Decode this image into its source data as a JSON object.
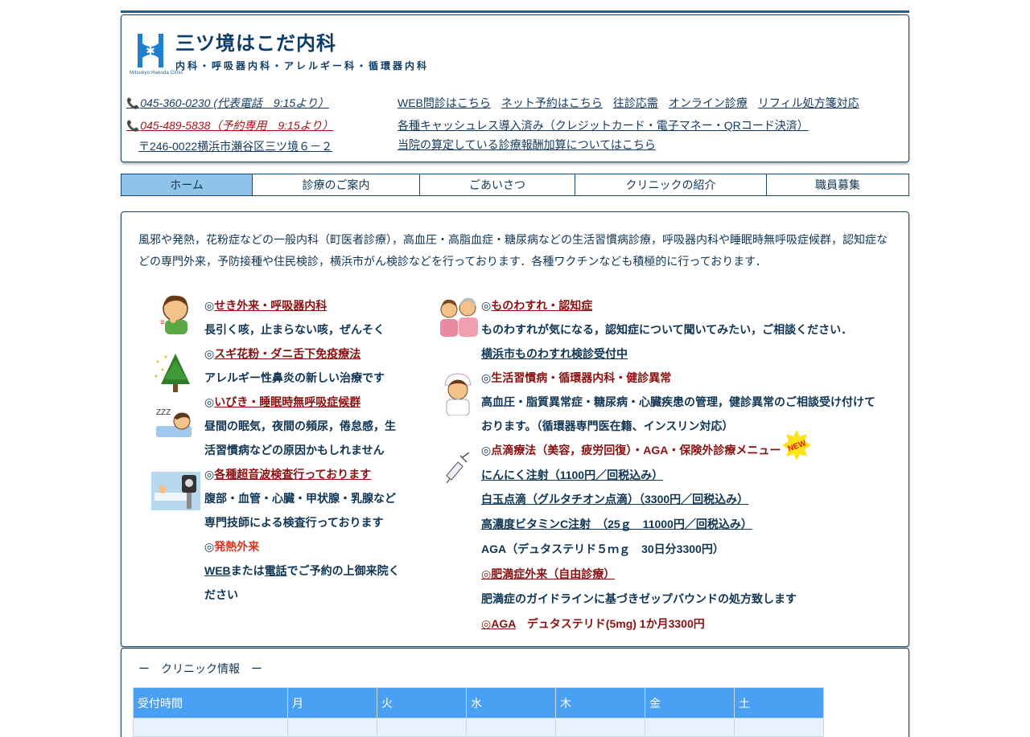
{
  "header": {
    "logo_small_text": "Mitsukyo Hakoda Clinic",
    "clinic_name": "三ツ境はこだ内科",
    "clinic_subtitle": "内科・呼吸器内科・アレルギー科・循環器内科",
    "phone_main": "045-360-0230 (代表電話　9:15より）",
    "phone_reserve": "045-489-5838（予約専用　9:15より）",
    "address": "〒246-0022横浜市瀬谷区三ツ境６－２",
    "links": [
      "WEB問診はこちら",
      "ネット予約はこちら",
      "往診応需",
      "オンライン診療",
      "リフィル処方箋対応"
    ],
    "cashless": "各種キャッシュレス導入済み（クレジットカード・電子マネー・QRコード決済）",
    "fee_link": "当院の算定している診療報酬加算についてはこちら"
  },
  "nav": {
    "tabs": [
      "ホーム",
      "診療のご案内",
      "ごあいさつ",
      "クリニックの紹介",
      "職員募集"
    ]
  },
  "main": {
    "intro": "風邪や発熱，花粉症などの一般内科（町医者診療），高血圧・高脂血症・糖尿病などの生活習慣病診療，呼吸器内科や睡眠時無呼吸症候群，認知症などの専門外来，予防接種や住民検診，横浜市がん検診などを行っております．各種ワクチンなども積極的に行っております．",
    "left": {
      "cough_mark": "◎",
      "cough_link": "せき外来・呼吸器内科",
      "cough_desc": "長引く咳，止まらない咳，ぜんそく",
      "pollen_mark": "◎",
      "pollen_link": "スギ花粉・ダニ舌下免疫療法",
      "pollen_desc": "アレルギー性鼻炎の新しい治療です",
      "sleep_mark": "◎",
      "sleep_link": "いびき・睡眠時無呼吸症候群",
      "sleep_desc_1": "昼間の眠気，夜間の頻尿，倦怠感，生",
      "sleep_desc_2": "活習慣病などの原因かもしれません",
      "echo_mark": "◎",
      "echo_link": "各種超音波検査行っております",
      "echo_desc_1": "腹部・血管・心臓・甲状腺・乳腺など",
      "echo_desc_2": "専門技師による検査行っております",
      "fever_mark": "◎",
      "fever_label": "発熱外来",
      "fever_web": "WEB",
      "fever_mid": "または",
      "fever_tel": "電話",
      "fever_rest_1": "でご予約の上御来院く",
      "fever_rest_2": "ださい"
    },
    "right": {
      "memory_mark": "◎",
      "memory_link": "ものわすれ・認知症",
      "memory_desc": "ものわすれが気になる，認知症について聞いてみたい，ご相談ください．",
      "memory_check": "横浜市ものわすれ検診受付中",
      "lifestyle_mark": "◎",
      "lifestyle_label": "生活習慣病・循環器内科・健診異常",
      "lifestyle_desc_1": "高血圧・脂質異常症・糖尿病・心臓疾患の管理，健診異常のご相談受け付けて",
      "lifestyle_desc_2": "おります。（循環器専門医在籍、インスリン対応）",
      "drip_mark": "◎",
      "drip_label": "点滴療法（美容，疲労回復）・AGA・保険外診療メニュー",
      "new_badge": "NEW",
      "garlic": "にんにく注射（1100円／回税込み）",
      "tama": "白玉点滴（グルタチオン点滴）（3300円／回税込み）",
      "vitc": "高濃度ビタミンC注射　（25ｇ　11000円／回税込み）",
      "aga_note": "AGA（デュタステリド５ｍｇ　30日分3300円）",
      "obesity_link": "◎肥満症外来（自由診療）",
      "obesity_desc": "肥満症のガイドラインに基づきゼップバウンドの処方致します",
      "aga_link": "◎AGA",
      "aga_desc": "　デュタステリド(5mg) 1か月3300円"
    }
  },
  "info": {
    "title": "ー　クリニック情報　ー",
    "columns": [
      "受付時間",
      "月",
      "火",
      "水",
      "木",
      "金",
      "土"
    ]
  }
}
